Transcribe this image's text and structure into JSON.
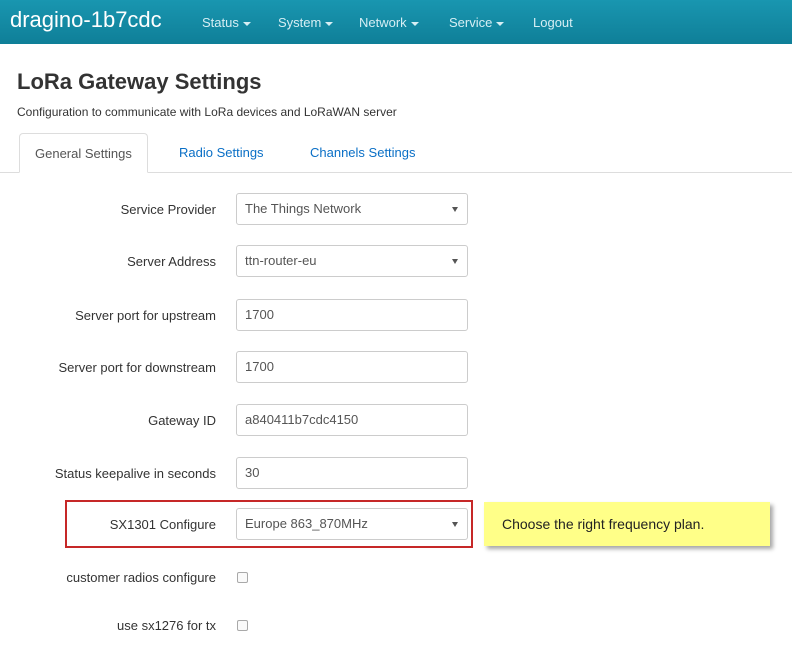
{
  "navbar": {
    "brand": "dragino-1b7cdc",
    "menu": [
      {
        "label": "Status"
      },
      {
        "label": "System"
      },
      {
        "label": "Network"
      },
      {
        "label": "Service"
      },
      {
        "label": "Logout"
      }
    ]
  },
  "page": {
    "title": "LoRa Gateway Settings",
    "description": "Configuration to communicate with LoRa devices and LoRaWAN server"
  },
  "tabs": [
    {
      "label": "General Settings",
      "active": true
    },
    {
      "label": "Radio Settings",
      "active": false
    },
    {
      "label": "Channels Settings",
      "active": false
    }
  ],
  "form": {
    "service_provider": {
      "label": "Service Provider",
      "value": "The Things Network"
    },
    "server_address": {
      "label": "Server Address",
      "value": "ttn-router-eu"
    },
    "upstream_port": {
      "label": "Server port for upstream",
      "value": "1700"
    },
    "downstream_port": {
      "label": "Server port for downstream",
      "value": "1700"
    },
    "gateway_id": {
      "label": "Gateway ID",
      "value": "a840411b7cdc4150"
    },
    "keepalive": {
      "label": "Status keepalive in seconds",
      "value": "30"
    },
    "sx1301": {
      "label": "SX1301 Configure",
      "value": "Europe 863_870MHz"
    },
    "customer_radios": {
      "label": "customer radios configure",
      "checked": false
    },
    "use_sx1276": {
      "label": "use sx1276 for tx",
      "checked": false
    }
  },
  "callout": {
    "text": "Choose  the right frequency plan."
  },
  "colors": {
    "navbar": "#1996b0",
    "link": "#0a6fc6",
    "highlight": "#c62828",
    "callout": "#ffff88"
  }
}
